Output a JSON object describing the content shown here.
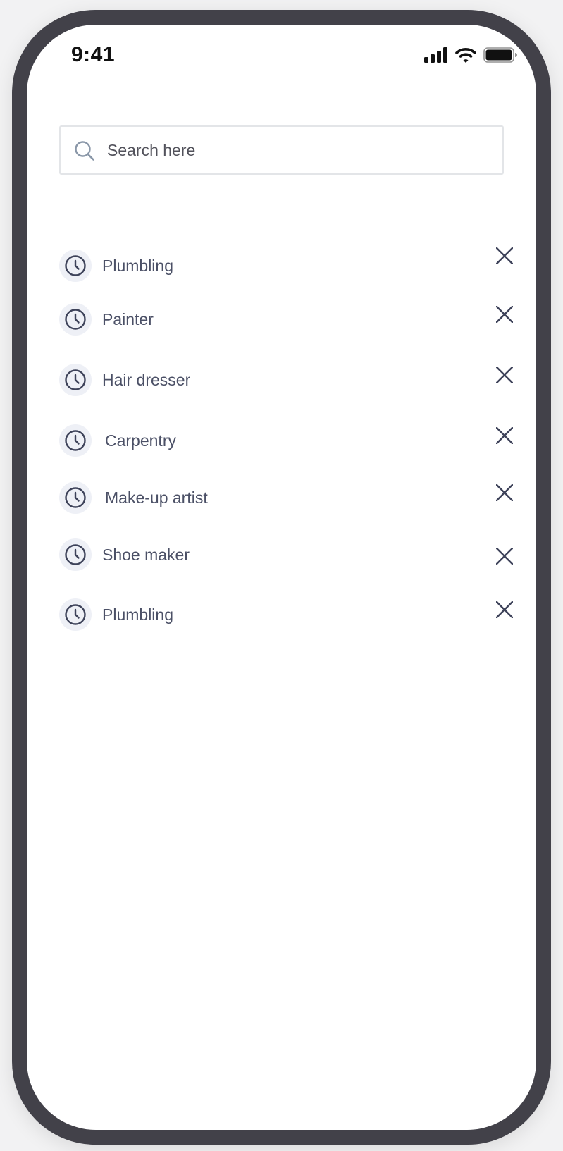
{
  "status_bar": {
    "time": "9:41",
    "icons": [
      "cellular-signal-icon",
      "wifi-icon",
      "battery-icon"
    ]
  },
  "search": {
    "placeholder": "Search here",
    "value": ""
  },
  "history": {
    "items": [
      {
        "label": "Plumbling"
      },
      {
        "label": "Painter"
      },
      {
        "label": "Hair dresser"
      },
      {
        "label": "Carpentry"
      },
      {
        "label": "Make-up artist"
      },
      {
        "label": "Shoe maker"
      },
      {
        "label": "Plumbling"
      }
    ]
  },
  "colors": {
    "frame": "#424149",
    "text": "#4b5066",
    "icon": "#3d4259",
    "search_icon": "#8a97a8",
    "badge_bg": "#eef0f6",
    "border": "#e3e5e8"
  }
}
